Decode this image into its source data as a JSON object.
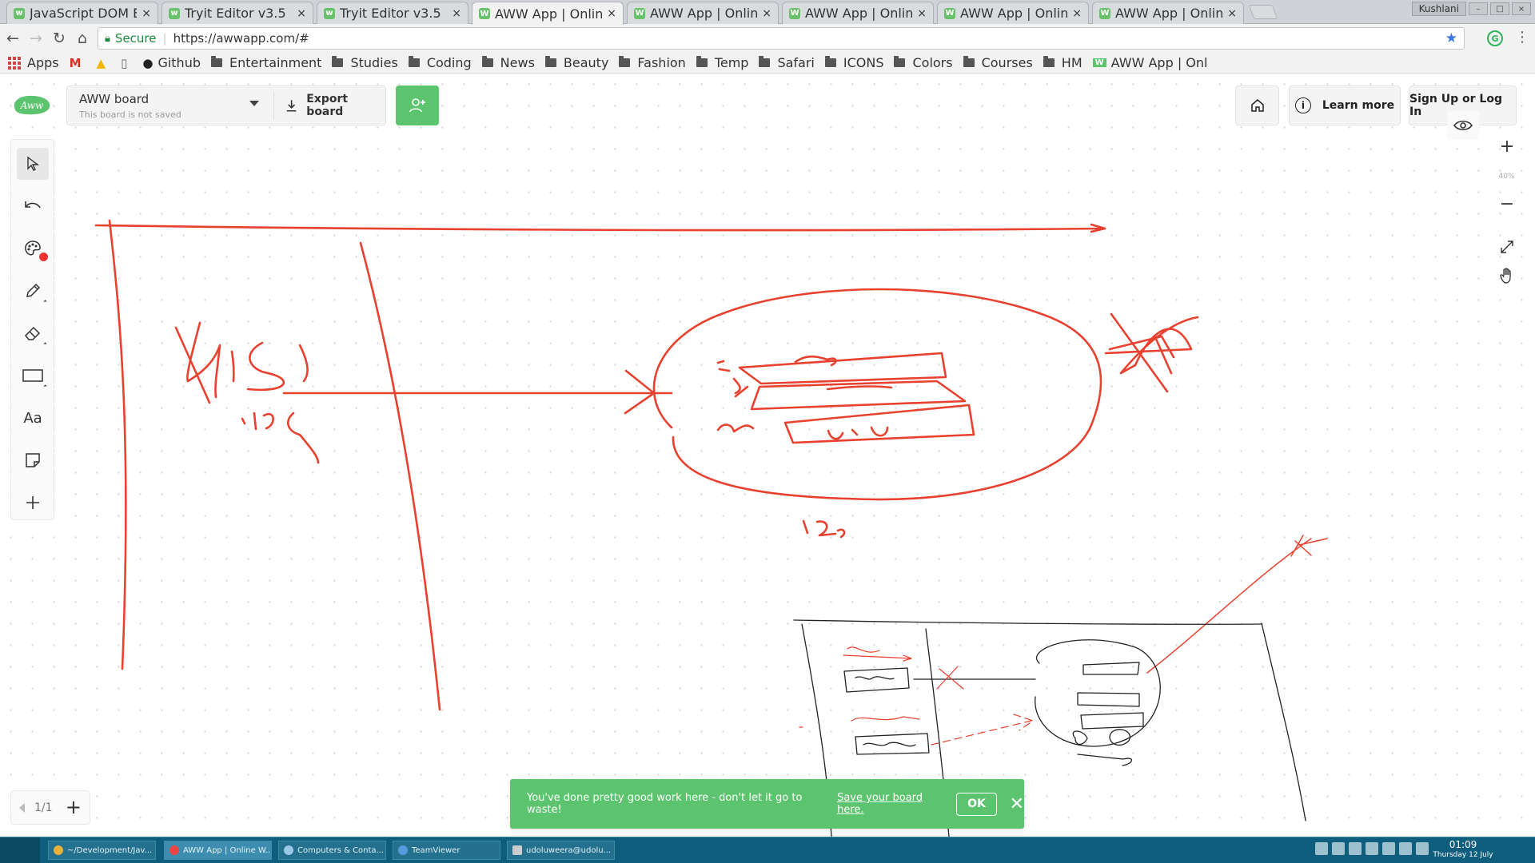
{
  "browser": {
    "tabs": [
      {
        "title": "JavaScript DOM Ele",
        "close": "×",
        "fav": "w"
      },
      {
        "title": "Tryit Editor v3.5",
        "close": "×",
        "fav": "w"
      },
      {
        "title": "Tryit Editor v3.5",
        "close": "×",
        "fav": "w"
      },
      {
        "title": "AWW App | Online",
        "close": "×",
        "fav": "W"
      },
      {
        "title": "AWW App | Online",
        "close": "×",
        "fav": "W"
      },
      {
        "title": "AWW App | Online",
        "close": "×",
        "fav": "W"
      },
      {
        "title": "AWW App | Online",
        "close": "×",
        "fav": "W"
      },
      {
        "title": "AWW App | Online",
        "close": "×",
        "fav": "W"
      }
    ],
    "profile_name": "Kushlani",
    "secure_label": "Secure",
    "url": "https://awwapp.com/#",
    "bookmarks": [
      "Apps",
      "Github",
      "Entertainment",
      "Studies",
      "Coding",
      "News",
      "Beauty",
      "Fashion",
      "Temp",
      "Safari",
      "ICONS",
      "Colors",
      "Courses",
      "HM",
      "AWW App | Onl"
    ]
  },
  "app": {
    "logo_text": "Aww",
    "board": {
      "name": "AWW board",
      "status": "This board is not saved",
      "export_label": "Export board"
    },
    "header": {
      "learn_more": "Learn more",
      "info_glyph": "i",
      "sign_up": "Sign Up or Log In"
    },
    "tools": {
      "text_tool": "Aa"
    },
    "zoom": {
      "plus": "+",
      "level": "40%",
      "minus": "−"
    },
    "pager": {
      "count": "1/1",
      "plus": "+"
    },
    "toast": {
      "message": "You've done pretty good work here - don't let it go to waste!",
      "link": "Save your board here.",
      "ok": "OK",
      "close": "✕"
    },
    "sketch": {
      "accent_color": "#e8412f",
      "thumbnail_ink": "#222222"
    }
  },
  "taskbar": {
    "items": [
      "~/Development/Jav...",
      "AWW App | Online W...",
      "Computers & Conta...",
      "TeamViewer",
      "udoluweera@udolu..."
    ],
    "time": "01:09",
    "date": "Thursday 12 July"
  }
}
